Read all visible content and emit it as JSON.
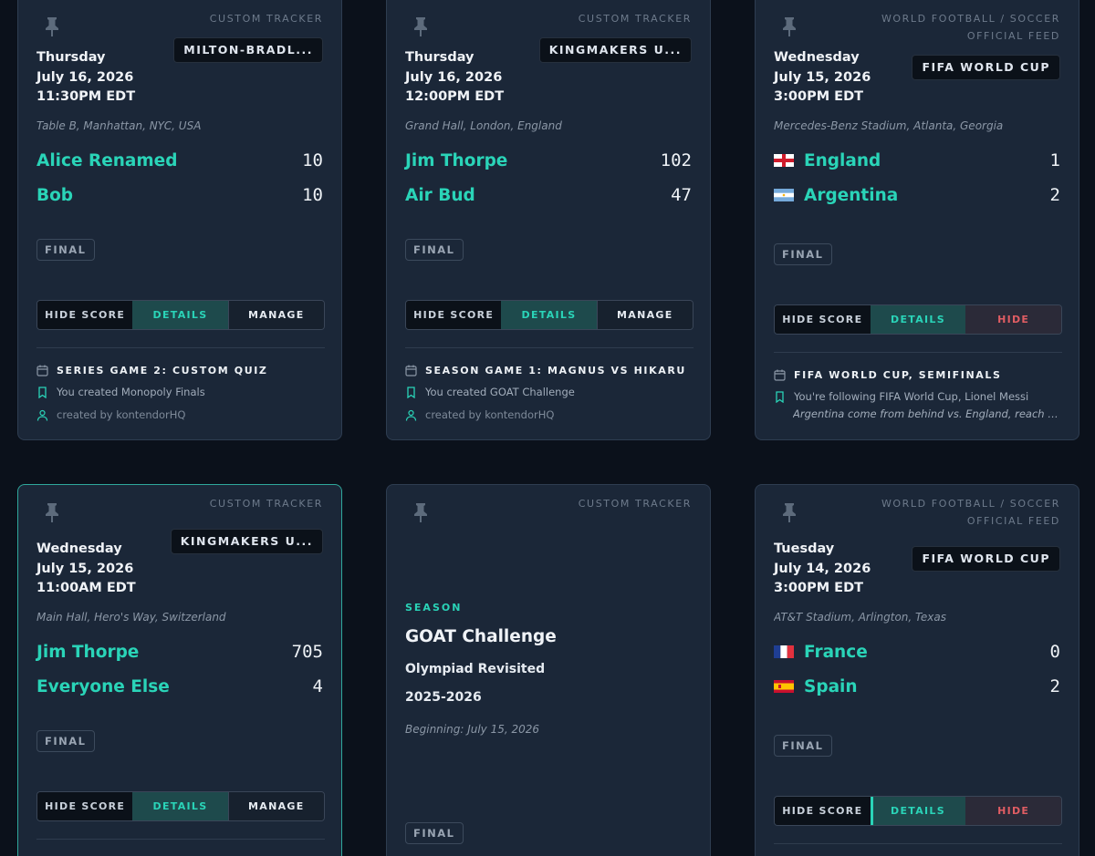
{
  "cards": [
    {
      "tag": "CUSTOM TRACKER",
      "league": "MILTON-BRADL...",
      "date": {
        "weekday": "Thursday",
        "day": "July 16, 2026",
        "time": "11:30PM EDT"
      },
      "location": "Table B, Manhattan, NYC, USA",
      "teams": [
        {
          "name": "Alice Renamed",
          "score": "10"
        },
        {
          "name": "Bob",
          "score": "10"
        }
      ],
      "status": "FINAL",
      "buttons": {
        "hide_score": "HIDE SCORE",
        "details": "DETAILS",
        "manage": "MANAGE"
      },
      "series": "SERIES GAME 2: CUSTOM QUIZ",
      "info": "You created Monopoly Finals",
      "creator": "created by kontendorHQ"
    },
    {
      "tag": "CUSTOM TRACKER",
      "league": "KINGMAKERS U...",
      "date": {
        "weekday": "Thursday",
        "day": "July 16, 2026",
        "time": "12:00PM EDT"
      },
      "location": "Grand Hall, London, England",
      "teams": [
        {
          "name": "Jim Thorpe",
          "score": "102"
        },
        {
          "name": "Air Bud",
          "score": "47"
        }
      ],
      "status": "FINAL",
      "buttons": {
        "hide_score": "HIDE SCORE",
        "details": "DETAILS",
        "manage": "MANAGE"
      },
      "series": "SEASON GAME 1: MAGNUS VS HIKARU",
      "info": "You created GOAT Challenge",
      "creator": "created by kontendorHQ"
    },
    {
      "tag_line1": "WORLD FOOTBALL / SOCCER",
      "tag_line2": "OFFICIAL FEED",
      "league": "FIFA WORLD CUP",
      "date": {
        "weekday": "Wednesday",
        "day": "July 15, 2026",
        "time": "3:00PM EDT"
      },
      "location": "Mercedes-Benz Stadium, Atlanta, Georgia",
      "teams": [
        {
          "name": "England",
          "score": "1",
          "flag": "england-flag"
        },
        {
          "name": "Argentina",
          "score": "2",
          "flag": "argentina-flag"
        }
      ],
      "status": "FINAL",
      "buttons": {
        "hide_score": "HIDE SCORE",
        "details": "DETAILS",
        "hide": "HIDE"
      },
      "series": "FIFA WORLD CUP, SEMIFINALS",
      "info": "You're following FIFA World Cup, Lionel Messi",
      "summary": "Argentina come from behind vs. England, reach WC..."
    },
    {
      "tag": "CUSTOM TRACKER",
      "league": "KINGMAKERS U...",
      "date": {
        "weekday": "Wednesday",
        "day": "July 15, 2026",
        "time": "11:00AM EDT"
      },
      "location": "Main Hall, Hero's Way, Switzerland",
      "teams": [
        {
          "name": "Jim Thorpe",
          "score": "705"
        },
        {
          "name": "Everyone Else",
          "score": "4"
        }
      ],
      "status": "FINAL",
      "buttons": {
        "hide_score": "HIDE SCORE",
        "details": "DETAILS",
        "manage": "MANAGE"
      }
    },
    {
      "tag": "CUSTOM TRACKER",
      "season_label": "SEASON",
      "title": "GOAT Challenge",
      "subtitle": "Olympiad Revisited",
      "years": "2025-2026",
      "beginning": "Beginning: July 15, 2026",
      "status": "FINAL"
    },
    {
      "tag_line1": "WORLD FOOTBALL / SOCCER",
      "tag_line2": "OFFICIAL FEED",
      "league": "FIFA WORLD CUP",
      "date": {
        "weekday": "Tuesday",
        "day": "July 14, 2026",
        "time": "3:00PM EDT"
      },
      "location": "AT&T Stadium, Arlington, Texas",
      "teams": [
        {
          "name": "France",
          "score": "0",
          "flag": "france-flag"
        },
        {
          "name": "Spain",
          "score": "2",
          "flag": "spain-flag"
        }
      ],
      "status": "FINAL",
      "buttons": {
        "hide_score": "HIDE SCORE",
        "details": "DETAILS",
        "hide": "HIDE"
      }
    }
  ],
  "colors": {
    "background": "#0b111b",
    "card": "#1b2738",
    "accent": "#2ad4b8",
    "danger": "#e05d63"
  }
}
